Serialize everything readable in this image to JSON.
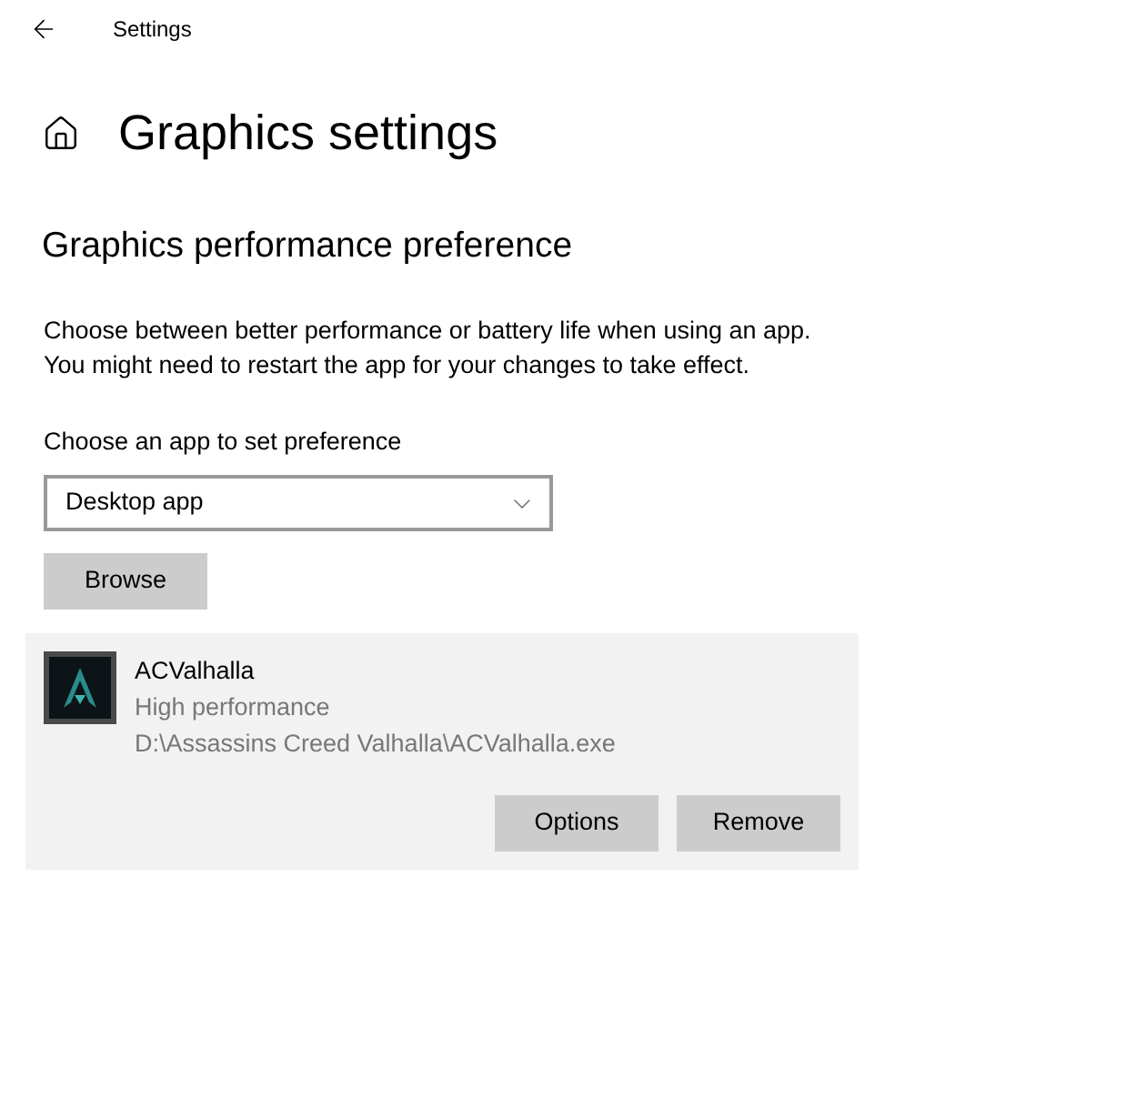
{
  "window": {
    "title": "Settings"
  },
  "page": {
    "title": "Graphics settings"
  },
  "section": {
    "title": "Graphics performance preference",
    "description": [
      "Choose between better performance or battery life when using an app.",
      "You might need to restart the app for your changes to take effect."
    ]
  },
  "app_picker": {
    "label": "Choose an app to set preference",
    "value": "Desktop app",
    "browse_button": "Browse"
  },
  "apps": [
    {
      "name": "ACValhalla",
      "preference": "High performance",
      "path": "D:\\Assassins Creed Valhalla\\ACValhalla.exe",
      "expanded": true,
      "buttons": [
        "Options",
        "Remove"
      ]
    }
  ]
}
